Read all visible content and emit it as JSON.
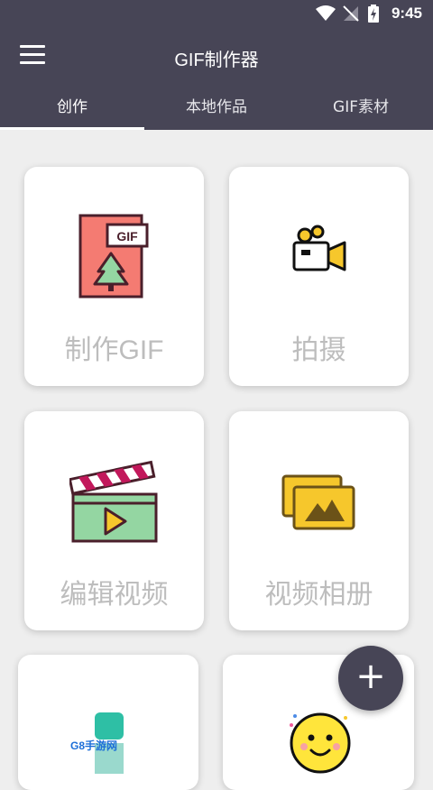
{
  "status": {
    "time": "9:45"
  },
  "app": {
    "title": "GIF制作器"
  },
  "tabs": [
    {
      "label": "创作",
      "active": true
    },
    {
      "label": "本地作品",
      "active": false
    },
    {
      "label": "GIF素材",
      "active": false
    }
  ],
  "cards": [
    {
      "label": "制作GIF",
      "icon": "gif-file-icon",
      "badge": "GIF"
    },
    {
      "label": "拍摄",
      "icon": "video-camera-icon"
    },
    {
      "label": "编辑视频",
      "icon": "clapperboard-play-icon"
    },
    {
      "label": "视频相册",
      "icon": "photo-album-icon"
    },
    {
      "label": "",
      "icon": "phone-icon"
    },
    {
      "label": "",
      "icon": "smiley-face-icon"
    }
  ],
  "fab": {
    "symbol": "+"
  },
  "watermark": {
    "text": "G8手游网"
  },
  "colors": {
    "bar": "#474556",
    "card_label": "#bdbdbd",
    "gif_doc": "#f47b72",
    "clapper_screen": "#94d6a2",
    "album": "#f6c72c",
    "smiley": "#ffe53b"
  }
}
